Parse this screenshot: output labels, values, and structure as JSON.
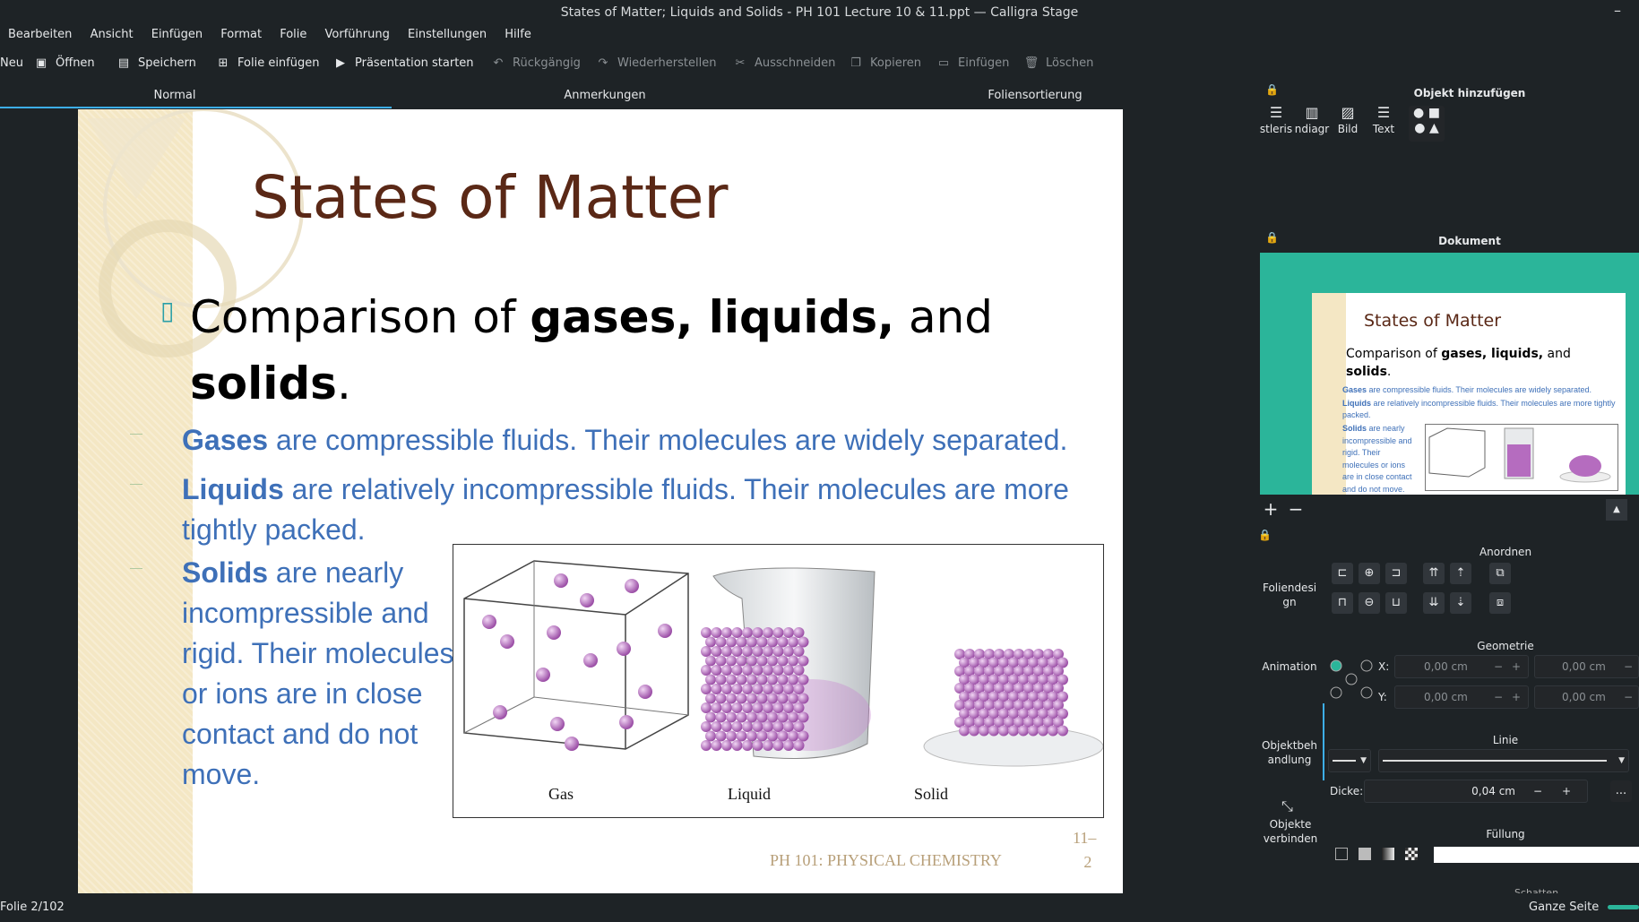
{
  "window": {
    "title": "States of Matter; Liquids and Solids - PH 101 Lecture 10 & 11.ppt — Calligra Stage"
  },
  "menu": [
    "Bearbeiten",
    "Ansicht",
    "Einfügen",
    "Format",
    "Folie",
    "Vorführung",
    "Einstellungen",
    "Hilfe"
  ],
  "toolbar": {
    "neu": "Neu",
    "oeffnen": "Öffnen",
    "speichern": "Speichern",
    "folie_einfuegen": "Folie einfügen",
    "praesentation": "Präsentation starten",
    "rueckgaengig": "Rückgängig",
    "wiederherstellen": "Wiederherstellen",
    "ausschneiden": "Ausschneiden",
    "kopieren": "Kopieren",
    "einfuegen": "Einfügen",
    "loeschen": "Löschen"
  },
  "views": {
    "normal": "Normal",
    "notes": "Anmerkungen",
    "sorter": "Foliensortierung"
  },
  "slide": {
    "title": "States of Matter",
    "bullet_plain1": "Comparison of ",
    "bullet_bold1": "gases, liquids,",
    "bullet_plain2": " and",
    "bullet_bold2": "solids",
    "bullet_end": ".",
    "gases_bold": "Gases",
    "gases_text": " are compressible fluids. Their molecules are widely separated.",
    "liquids_bold": "Liquids",
    "liquids_text": " are relatively incompressible fluids. Their molecules are more",
    "liquids_text2": "tightly packed.",
    "solids_bold": "Solids",
    "solids_l1": " are nearly",
    "solids_l2": "incompressible and",
    "solids_l3": "rigid. Their molecules",
    "solids_l4": "or ions are in close",
    "solids_l5": "contact and do not",
    "solids_l6": "move.",
    "fig_gas": "Gas",
    "fig_liquid": "Liquid",
    "fig_solid": "Solid",
    "footer": "PH 101: PHYSICAL CHEMISTRY",
    "page_num1": "11–",
    "page_num2": "2"
  },
  "panel": {
    "add_object": "Objekt hinzufügen",
    "add_items": [
      "stleris",
      "ndiagr",
      "Bild",
      "Text"
    ],
    "document": "Dokument",
    "thumb_title": "States of Matter",
    "thumb_b1": "Comparison of ",
    "thumb_b1b": "gases, liquids,",
    "thumb_b1c": " and",
    "thumb_b2": "solids",
    "thumb_g": "Gases",
    "thumb_gt": " are compressible fluids. Their molecules are widely separated.",
    "thumb_l": "Liquids",
    "thumb_lt": " are relatively incompressible fluids. Their molecules are more tightly packed.",
    "thumb_s": "Solids",
    "thumb_st": " are nearly incompressible and rigid. Their molecules or ions are in close contact and do not move.",
    "side_tabs": [
      "Foliendesi gn",
      "Animation",
      "Objektbeh andlung",
      "Objekte verbinden"
    ],
    "arrange": "Anordnen",
    "geometry": "Geometrie",
    "x_label": "X:",
    "y_label": "Y:",
    "x_val": "0,00 cm",
    "y_val": "0,00 cm",
    "w_val": "0,00 cm",
    "h_val": "0,00 cm",
    "line": "Linie",
    "thickness_label": "Dicke:",
    "thickness_val": "0,04 cm",
    "more": "...",
    "fill": "Füllung",
    "shadow": "Schatten"
  },
  "status": {
    "slide": "Folie 2/102",
    "zoom": "Ganze Seite"
  }
}
